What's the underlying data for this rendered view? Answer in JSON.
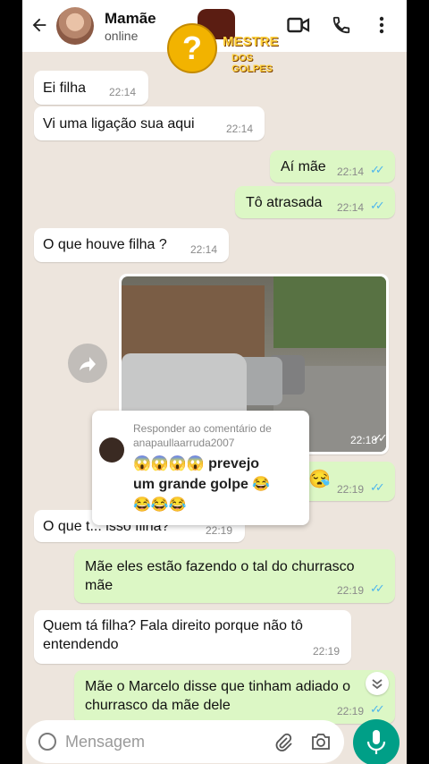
{
  "header": {
    "contact_name": "Mamãe",
    "status": "online"
  },
  "watermark": {
    "line1": "MESTRE",
    "line2": "DOS GOLPES",
    "mark": "?"
  },
  "messages": [
    {
      "dir": "in",
      "text": "Ei filha",
      "time": "22:14"
    },
    {
      "dir": "in",
      "text": "Vi uma ligação sua aqui",
      "time": "22:14"
    },
    {
      "dir": "out",
      "text": "Aí mãe",
      "time": "22:14"
    },
    {
      "dir": "out",
      "text": "Tô atrasada",
      "time": "22:14"
    },
    {
      "dir": "in",
      "text": "O que houve filha ?",
      "time": "22:14"
    },
    {
      "dir": "out",
      "type": "image",
      "time": "22:18"
    },
    {
      "dir": "out",
      "text": "😪",
      "time": "22:19"
    },
    {
      "dir": "in",
      "text": "O que t... isso filha?",
      "time": "22:19"
    },
    {
      "dir": "out",
      "text": "Mãe eles estão fazendo o tal do churrasco mãe",
      "line1": "Mãe eles estão fazendo o tal do churrasco",
      "line2": "mãe",
      "time": "22:19"
    },
    {
      "dir": "in",
      "text": "Quem tá filha? Fala direito porque não tô entendendo",
      "line1": "Quem tá filha? Fala direito porque não tô",
      "line2": "entendendo",
      "time": "22:19"
    },
    {
      "dir": "out",
      "text": "Mãe o Marcelo disse que tinham adiado o churrasco da mãe dele",
      "line1": "Mãe o Marcelo disse que tinham adiado o",
      "line2": "churrasco da mãe dele",
      "time": "22:19"
    }
  ],
  "comment_overlay": {
    "title": "Responder ao comentário de anapaullaarruda2007",
    "title_line1": "Responder ao comentário de",
    "title_line2": "anapaullaarruda2007",
    "text_line1": "😱😱😱😱 prevejo",
    "text_line2": "um grande golpe 😂",
    "text_line3": "😂😂😂"
  },
  "composer": {
    "placeholder": "Mensagem"
  },
  "colors": {
    "chat_bg": "#ede5dd",
    "outgoing_bubble": "#dcf7c5",
    "incoming_bubble": "#ffffff",
    "read_ticks": "#4fb6ec",
    "mic_button": "#009f87"
  },
  "icons": [
    "back-arrow-icon",
    "video-call-icon",
    "phone-icon",
    "more-vert-icon",
    "forward-icon",
    "chevron-down-icon",
    "emoji-icon",
    "attach-icon",
    "camera-icon",
    "mic-icon",
    "double-check-icon"
  ]
}
